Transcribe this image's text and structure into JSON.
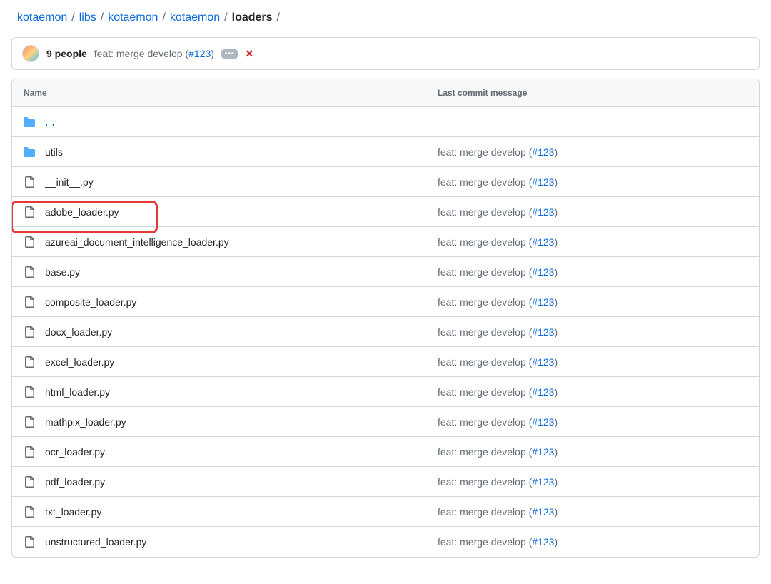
{
  "breadcrumb": {
    "items": [
      {
        "label": "kotaemon",
        "link": true
      },
      {
        "label": "libs",
        "link": true
      },
      {
        "label": "kotaemon",
        "link": true
      },
      {
        "label": "kotaemon",
        "link": true
      },
      {
        "label": "loaders",
        "link": false
      }
    ],
    "trailing_slash": "/"
  },
  "commit_bar": {
    "people": "9 people",
    "message_prefix": "feat: merge develop (",
    "pr_ref": "#123",
    "message_suffix": ")",
    "ellipsis": "•••",
    "status": "✕"
  },
  "table": {
    "headers": {
      "name": "Name",
      "commit": "Last commit message"
    },
    "parent_label": ". .",
    "commit_template": {
      "prefix": "feat: merge develop (",
      "pr": "#123",
      "suffix": ")"
    },
    "rows": [
      {
        "icon": "folder",
        "name": "utils"
      },
      {
        "icon": "file",
        "name": "__init__.py"
      },
      {
        "icon": "file",
        "name": "adobe_loader.py",
        "highlight": true
      },
      {
        "icon": "file",
        "name": "azureai_document_intelligence_loader.py"
      },
      {
        "icon": "file",
        "name": "base.py"
      },
      {
        "icon": "file",
        "name": "composite_loader.py"
      },
      {
        "icon": "file",
        "name": "docx_loader.py"
      },
      {
        "icon": "file",
        "name": "excel_loader.py"
      },
      {
        "icon": "file",
        "name": "html_loader.py"
      },
      {
        "icon": "file",
        "name": "mathpix_loader.py"
      },
      {
        "icon": "file",
        "name": "ocr_loader.py"
      },
      {
        "icon": "file",
        "name": "pdf_loader.py"
      },
      {
        "icon": "file",
        "name": "txt_loader.py"
      },
      {
        "icon": "file",
        "name": "unstructured_loader.py"
      }
    ]
  }
}
